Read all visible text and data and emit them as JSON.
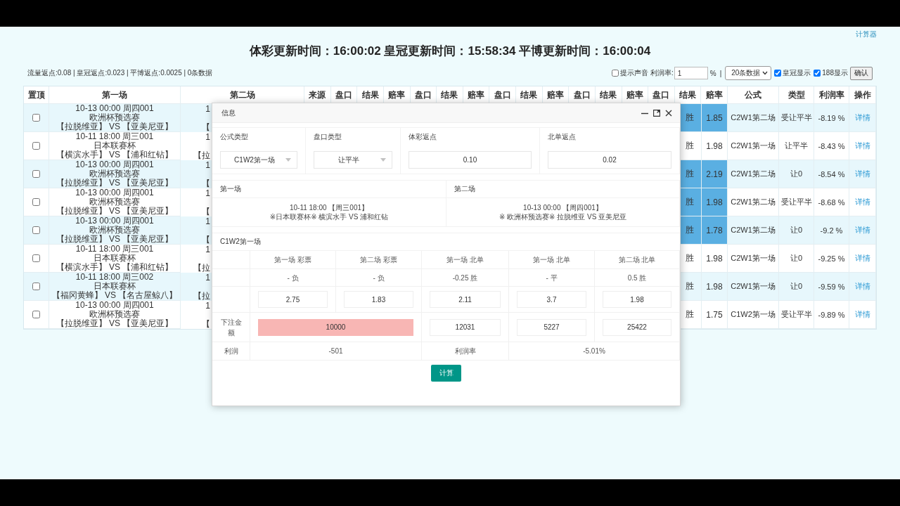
{
  "header": {
    "calculator_link": "计算器",
    "title": "体彩更新时间：16:00:02 皇冠更新时间：15:58:34 平博更新时间：16:00:04"
  },
  "toolbar": {
    "summary": "流量返点:0.08 | 皇冠返点:0.023 | 平博返点:0.0025 | 0条数据",
    "sound": {
      "label": "提示声音",
      "checked": false
    },
    "profit_label": "利润率:",
    "profit_value": "1",
    "percent": "%",
    "separator": "|",
    "page_size": "20条数据",
    "toggles": [
      {
        "label": "皇冠显示",
        "checked": true
      },
      {
        "label": "188显示",
        "checked": true
      }
    ],
    "confirm": "确认"
  },
  "table": {
    "columns": [
      "置顶",
      "第一场",
      "第二场",
      "来源",
      "盘口",
      "结果",
      "赔率",
      "盘口",
      "结果",
      "赔率",
      "盘口",
      "结果",
      "赔率",
      "盘口",
      "结果",
      "赔率",
      "盘口",
      "结果",
      "赔率",
      "公式",
      "类型",
      "利润率",
      "操作"
    ],
    "rows": [
      {
        "pinned": false,
        "match_1": [
          "10-13 00:00 周四001",
          "欧洲杯预选赛",
          "【拉脱维亚】 VS 【亚美尼亚】"
        ],
        "match_2": [
          "1",
          "【"
        ],
        "result": "胜",
        "odds": "1.85",
        "highlighted": true,
        "formula": "C2W1第二场",
        "type": "受让平半",
        "profit_rate": "-8.19 %",
        "action": "详情"
      },
      {
        "pinned": false,
        "match_1": [
          "10-11 18:00 周三001",
          "日本联赛杯",
          "【横滨水手】 VS 【浦和红钻】"
        ],
        "match_2": [
          "1",
          "【拉"
        ],
        "result": "胜",
        "odds": "1.98",
        "highlighted": false,
        "formula": "C2W1第一场",
        "type": "让平半",
        "profit_rate": "-8.43 %",
        "action": "详情"
      },
      {
        "pinned": false,
        "match_1": [
          "10-13 00:00 周四001",
          "欧洲杯预选赛",
          "【拉脱维亚】 VS 【亚美尼亚】"
        ],
        "match_2": [
          "1",
          "【"
        ],
        "result": "胜",
        "odds": "2.19",
        "highlighted": true,
        "formula": "C2W1第二场",
        "type": "让0",
        "profit_rate": "-8.54 %",
        "action": "详情"
      },
      {
        "pinned": false,
        "match_1": [
          "10-13 00:00 周四001",
          "欧洲杯预选赛",
          "【拉脱维亚】 VS 【亚美尼亚】"
        ],
        "match_2": [
          "1",
          "【"
        ],
        "result": "胜",
        "odds": "1.98",
        "highlighted": true,
        "formula": "C2W1第二场",
        "type": "受让平半",
        "profit_rate": "-8.68 %",
        "action": "详情"
      },
      {
        "pinned": false,
        "match_1": [
          "10-13 00:00 周四001",
          "欧洲杯预选赛",
          "【拉脱维亚】 VS 【亚美尼亚】"
        ],
        "match_2": [
          "1",
          "【"
        ],
        "result": "胜",
        "odds": "1.78",
        "highlighted": true,
        "formula": "C2W1第二场",
        "type": "让0",
        "profit_rate": "-9.2 %",
        "action": "详情"
      },
      {
        "pinned": false,
        "match_1": [
          "10-11 18:00 周三001",
          "日本联赛杯",
          "【横滨水手】 VS 【浦和红钻】"
        ],
        "match_2": [
          "1",
          "【拉"
        ],
        "result": "胜",
        "odds": "1.98",
        "highlighted": false,
        "formula": "C2W1第一场",
        "type": "让0",
        "profit_rate": "-9.25 %",
        "action": "详情"
      },
      {
        "pinned": false,
        "match_1": [
          "10-11 18:00 周三002",
          "日本联赛杯",
          "【福冈黄蜂】 VS 【名古屋鲸八】"
        ],
        "match_2": [
          "1",
          "【拉"
        ],
        "result": "胜",
        "odds": "1.98",
        "highlighted": false,
        "formula": "C2W1第一场",
        "type": "让0",
        "profit_rate": "-9.59 %",
        "action": "详情"
      },
      {
        "pinned": false,
        "match_1": [
          "10-13 00:00 周四001",
          "欧洲杯预选赛",
          "【拉脱维亚】 VS 【亚美尼亚】"
        ],
        "match_2": [
          "1",
          "【"
        ],
        "result": "胜",
        "odds": "1.75",
        "highlighted": false,
        "formula": "C1W2第一场",
        "type": "受让平半",
        "profit_rate": "-9.89 %",
        "action": "详情"
      }
    ]
  },
  "dialog": {
    "title": "信息",
    "form": [
      {
        "label": "公式类型",
        "kind": "select",
        "value": "C1W2第一场"
      },
      {
        "label": "盘口类型",
        "kind": "select",
        "value": "让平半"
      },
      {
        "label": "体彩返点",
        "kind": "input",
        "value": "0.10"
      },
      {
        "label": "北单返点",
        "kind": "input",
        "value": "0.02"
      }
    ],
    "matches": [
      {
        "heading": "第一场",
        "lines": [
          "10-11 18:00 【周三001】",
          "※日本联赛杯※ 横滨水手 VS 浦和红钻"
        ]
      },
      {
        "heading": "第二场",
        "lines": [
          "10-13 00:00 【周四001】",
          "※ 欧洲杯预选赛※ 拉脱维亚 VS 亚美尼亚"
        ]
      }
    ],
    "calc": {
      "heading": "C1W2第一场",
      "columns": [
        "第一场 彩票",
        "第二场 彩票",
        "第一场 北单",
        "第一场 北单",
        "第二场 北单"
      ],
      "picks": [
        "- 负",
        "- 负",
        "-0.25 胜",
        "- 平",
        "0.5 胜"
      ],
      "odds": [
        "2.75",
        "1.83",
        "2.11",
        "3.7",
        "1.98"
      ],
      "stake_label": "下注金额",
      "stake_main": {
        "value": "10000",
        "highlighted": true
      },
      "stakes": [
        "12031",
        "5227",
        "25422"
      ],
      "profit_label": "利润",
      "profit": "-501",
      "rate_label": "利润率",
      "rate": "-5.01%",
      "button": "计算"
    }
  }
}
